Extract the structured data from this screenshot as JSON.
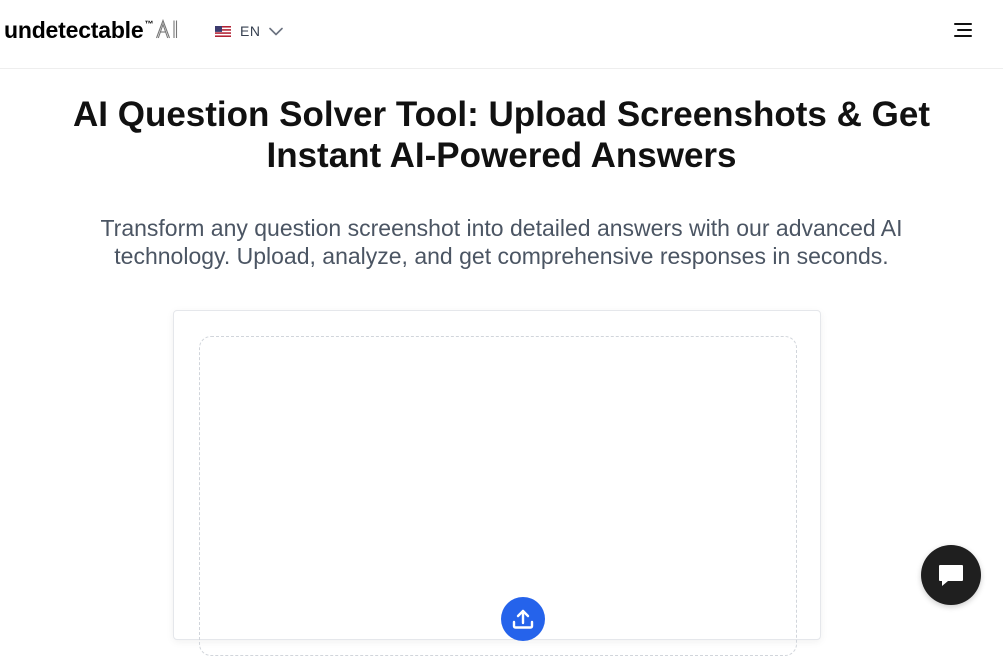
{
  "header": {
    "logo_text": "undetectable",
    "logo_tm": "™",
    "logo_ai": "AI",
    "language_code": "EN",
    "flag_icon": "us-flag-icon",
    "chevron_icon": "chevron-down-icon",
    "menu_icon": "hamburger-menu-icon"
  },
  "hero": {
    "title_line1": "AI Question Solver Tool: Upload Screenshots & Get",
    "title_line2": "Instant AI-Powered Answers",
    "subtitle_line1": "Transform any question screenshot into detailed answers with our advanced AI",
    "subtitle_line2": "technology. Upload, analyze, and get comprehensive responses in seconds."
  },
  "upload": {
    "icon": "upload-icon",
    "accent_color": "#2563eb"
  },
  "chat": {
    "icon": "chat-bubble-icon",
    "color": "#1f1f1f"
  }
}
